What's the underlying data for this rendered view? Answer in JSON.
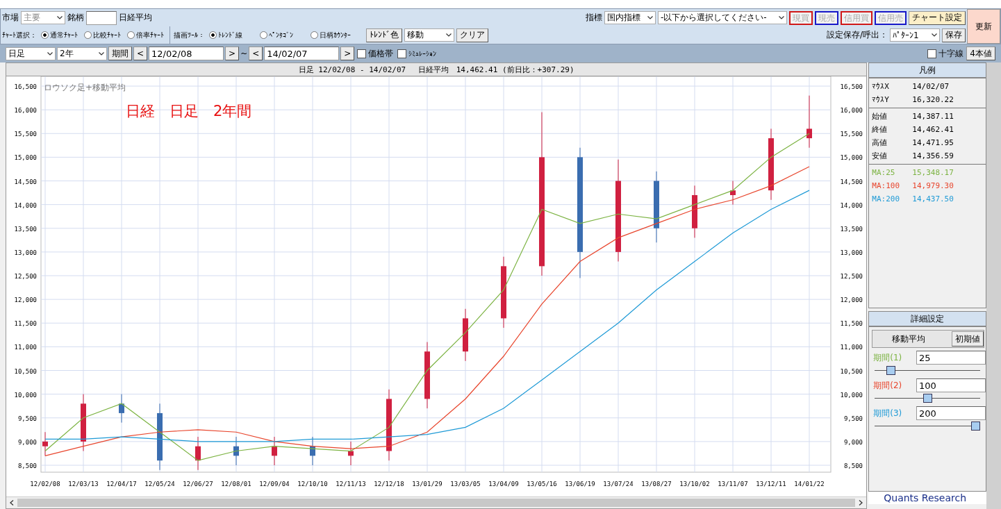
{
  "toolbar": {
    "market_label": "市場",
    "market_value": "主要",
    "symbol_label": "銘柄",
    "symbol_name": "日経平均",
    "indicator_label": "指標",
    "indicator_value": "国内指標",
    "indicator_sub_value": "-以下から選択してください-",
    "trade_buttons": [
      {
        "label": "現買",
        "color": "#d01818",
        "disabled": true
      },
      {
        "label": "現売",
        "color": "#1818c8",
        "disabled": true
      },
      {
        "label": "信用買",
        "color": "#d01818",
        "disabled": true
      },
      {
        "label": "信用売",
        "color": "#1818c8",
        "disabled": true
      }
    ],
    "chart_settings_button": "チャート設定",
    "refresh_button": "更新",
    "save_label": "設定保存/呼出：",
    "pattern_value": "ﾊﾟﾀｰﾝ1",
    "save_button": "保存",
    "chart_select_label": "ﾁｬｰﾄ選択：",
    "chart_types": [
      {
        "label": "通常ﾁｬｰﾄ",
        "selected": true
      },
      {
        "label": "比較ﾁｬｰﾄ",
        "selected": false
      },
      {
        "label": "倍率ﾁｬｰﾄ",
        "selected": false
      }
    ],
    "draw_tool_label": "描画ﾂｰﾙ：",
    "draw_tools": [
      {
        "label": "ﾄﾚﾝﾄﾞ線",
        "selected": true
      },
      {
        "label": "ﾍﾟﾝﾀｺﾞﾝ",
        "selected": false
      },
      {
        "label": "日柄ｶｳﾝﾀｰ",
        "selected": false
      }
    ],
    "trend_color_button": "ﾄﾚﾝﾄﾞ色",
    "move_value": "移動",
    "clear_button": "クリア"
  },
  "range_bar": {
    "interval_value": "日足",
    "span_value": "2年",
    "period_button": "期間",
    "prev": "<",
    "from_date": "12/02/08",
    "next": ">",
    "tilde": "~",
    "prev2": "<",
    "to_date": "14/02/07",
    "next2": ">",
    "checkboxes": [
      {
        "label": "価格帯",
        "checked": false
      },
      {
        "label": "ｼﾐｭﾚｰｼｮﾝ",
        "checked": false
      }
    ],
    "crosshair": {
      "label": "十字線",
      "checked": false
    },
    "ohlc_button": "4本値"
  },
  "chart": {
    "header": "日足 12/02/08 - 14/02/07　 日経平均　14,462.41 (前日比：+307.29)",
    "caption": "ロウソク足+移動平均",
    "annotation": "日経　日足　2年間",
    "chart_data": {
      "type": "candlestick",
      "grid": true,
      "categories": [
        "12/02/08",
        "12/03/13",
        "12/04/17",
        "12/05/24",
        "12/06/27",
        "12/08/01",
        "12/09/04",
        "12/10/10",
        "12/11/13",
        "12/12/18",
        "13/01/29",
        "13/03/05",
        "13/04/09",
        "13/05/16",
        "13/06/19",
        "13/07/24",
        "13/08/27",
        "13/10/02",
        "13/11/07",
        "13/12/11",
        "14/01/22"
      ],
      "ylim": [
        8500,
        16500
      ],
      "yticks": [
        {
          "value": 8500,
          "label": "8,500"
        },
        {
          "value": 9000,
          "label": "9,000"
        },
        {
          "value": 9500,
          "label": "9,500"
        },
        {
          "value": 10000,
          "label": "10,000"
        },
        {
          "value": 10500,
          "label": "10,500"
        },
        {
          "value": 11000,
          "label": "11,000"
        },
        {
          "value": 11500,
          "label": "11,500"
        },
        {
          "value": 12000,
          "label": "12,000"
        },
        {
          "value": 12500,
          "label": "12,500"
        },
        {
          "value": 13000,
          "label": "13,000"
        },
        {
          "value": 13500,
          "label": "13,500"
        },
        {
          "value": 14000,
          "label": "14,000"
        },
        {
          "value": 14500,
          "label": "14,500"
        },
        {
          "value": 15000,
          "label": "15,000"
        },
        {
          "value": 15500,
          "label": "15,500"
        },
        {
          "value": 16000,
          "label": "16,000"
        },
        {
          "value": 16500,
          "label": "16,500"
        }
      ],
      "ohlc": [
        [
          8900,
          9200,
          8700,
          9000
        ],
        [
          9000,
          10000,
          8800,
          9800
        ],
        [
          9800,
          10000,
          9400,
          9600
        ],
        [
          9600,
          9800,
          8400,
          8600
        ],
        [
          8600,
          9100,
          8400,
          8900
        ],
        [
          8900,
          9100,
          8500,
          8700
        ],
        [
          8700,
          9100,
          8500,
          8900
        ],
        [
          8900,
          9100,
          8500,
          8700
        ],
        [
          8700,
          9000,
          8500,
          8800
        ],
        [
          8800,
          10100,
          8600,
          9900
        ],
        [
          9900,
          11100,
          9700,
          10900
        ],
        [
          10900,
          11800,
          10700,
          11600
        ],
        [
          11600,
          12900,
          11400,
          12700
        ],
        [
          12700,
          15950,
          12500,
          15000
        ],
        [
          15000,
          15200,
          12450,
          13000
        ],
        [
          13000,
          14950,
          12800,
          14500
        ],
        [
          14500,
          14700,
          13200,
          13500
        ],
        [
          13500,
          14400,
          13300,
          14200
        ],
        [
          14200,
          14500,
          14000,
          14300
        ],
        [
          14300,
          15600,
          14100,
          15400
        ],
        [
          15400,
          16300,
          15200,
          15600
        ]
      ],
      "series": [
        {
          "name": "MA:25",
          "type": "line",
          "color": "#7cb342",
          "values": [
            8800,
            9500,
            9800,
            9200,
            8600,
            8800,
            8900,
            8850,
            8800,
            9300,
            10500,
            11300,
            12200,
            13900,
            13600,
            13800,
            13700,
            14000,
            14300,
            15000,
            15500
          ]
        },
        {
          "name": "MA:100",
          "type": "line",
          "color": "#e8452c",
          "values": [
            8700,
            8900,
            9100,
            9200,
            9250,
            9200,
            9000,
            8900,
            8850,
            8900,
            9200,
            9900,
            10800,
            11900,
            12800,
            13300,
            13600,
            13900,
            14100,
            14400,
            14800
          ]
        },
        {
          "name": "MA:200",
          "type": "line",
          "color": "#1e9ad6",
          "values": [
            9050,
            9050,
            9100,
            9050,
            9000,
            9000,
            9000,
            9050,
            9050,
            9100,
            9150,
            9300,
            9700,
            10300,
            10900,
            11500,
            12200,
            12800,
            13400,
            13900,
            14300
          ]
        }
      ]
    }
  },
  "legend": {
    "title": "凡例",
    "groups": [
      [
        {
          "label": "ﾏｳｽX",
          "value": "14/02/07"
        },
        {
          "label": "ﾏｳｽY",
          "value": "16,320.22"
        }
      ],
      [
        {
          "label": "始値",
          "value": "14,387.11"
        },
        {
          "label": "終値",
          "value": "14,462.41"
        },
        {
          "label": "高値",
          "value": "14,471.95"
        },
        {
          "label": "安値",
          "value": "14,356.59"
        }
      ]
    ],
    "ma_values": [
      "15,348.17",
      "14,979.30",
      "14,437.50"
    ]
  },
  "settings": {
    "title": "詳細設定",
    "tab": "移動平均",
    "reset_button": "初期値",
    "periods": [
      {
        "label": "期間(1)",
        "value": "25",
        "color": "#7cb342",
        "level": 0.12
      },
      {
        "label": "期間(2)",
        "value": "100",
        "color": "#e8452c",
        "level": 0.5
      },
      {
        "label": "期間(3)",
        "value": "200",
        "color": "#1e9ad6",
        "level": 1
      }
    ]
  },
  "footer_logo": "Quants Research"
}
